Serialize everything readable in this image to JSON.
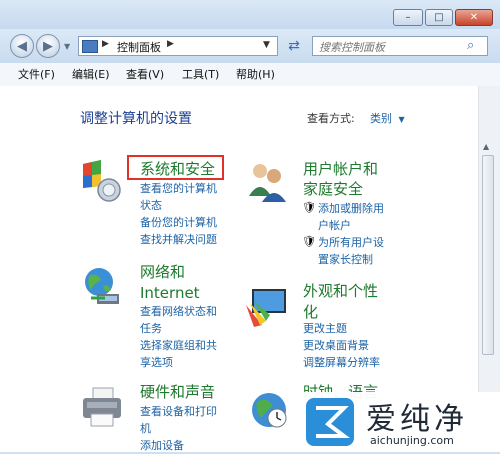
{
  "window": {
    "min_glyph": "–",
    "max_glyph": "□",
    "close_glyph": "✕"
  },
  "address": {
    "breadcrumb": "控制面板"
  },
  "search": {
    "placeholder": "搜索控制面板"
  },
  "menu": [
    "文件(F)",
    "编辑(E)",
    "查看(V)",
    "工具(T)",
    "帮助(H)"
  ],
  "header": {
    "title": "调整计算机的设置",
    "view_label": "查看方式:",
    "view_value": "类别"
  },
  "categories": {
    "system": {
      "title": "系统和安全",
      "links": [
        "查看您的计算机",
        "状态",
        "备份您的计算机",
        "查找并解决问题"
      ]
    },
    "network": {
      "title1": "网络和",
      "title2": "Internet",
      "links": [
        "查看网络状态和",
        "任务",
        "选择家庭组和共",
        "享选项"
      ]
    },
    "hardware": {
      "title": "硬件和声音",
      "links": [
        "查看设备和打印",
        "机",
        "添加设备"
      ]
    },
    "users": {
      "title1": "用户帐户和",
      "title2": "家庭安全",
      "links": [
        "添加或删除用",
        "户帐户",
        "为所有用户设",
        "置家长控制"
      ]
    },
    "appearance": {
      "title1": "外观和个性",
      "title2": "化",
      "links": [
        "更改主题",
        "更改桌面背景",
        "调整屏幕分辨率"
      ]
    },
    "clock": {
      "title": "时钟、语言"
    }
  },
  "watermark": {
    "brand": "爱纯净",
    "url": "aichunjing.com"
  }
}
